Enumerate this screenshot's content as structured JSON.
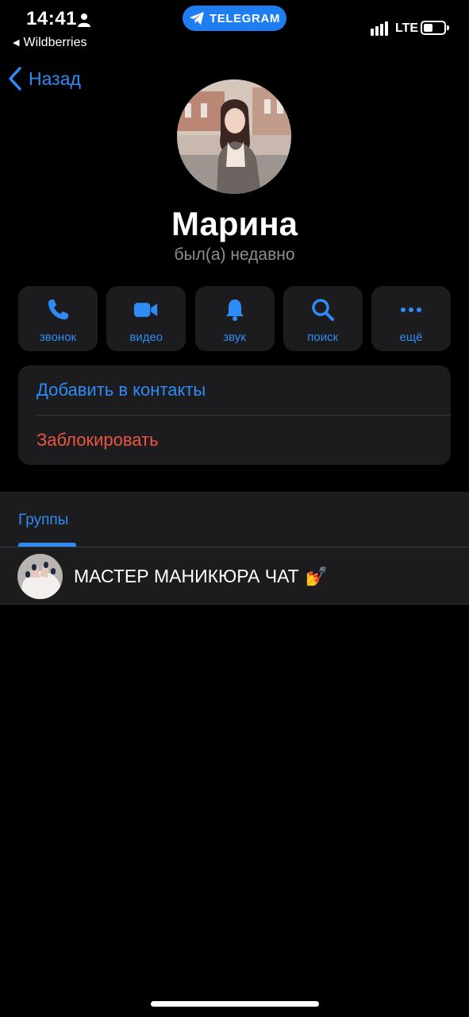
{
  "status_bar": {
    "time": "14:41",
    "back_app": "Wildberries",
    "pill_label": "TELEGRAM",
    "network": "LTE",
    "battery_level": 0.45
  },
  "nav": {
    "back_label": "Назад"
  },
  "profile": {
    "name": "Марина",
    "last_seen": "был(а) недавно"
  },
  "actions": [
    {
      "label": "звонок",
      "icon": "phone-icon"
    },
    {
      "label": "видео",
      "icon": "video-camera-icon"
    },
    {
      "label": "звук",
      "icon": "bell-icon"
    },
    {
      "label": "поиск",
      "icon": "search-icon"
    },
    {
      "label": "ещё",
      "icon": "more-dots-icon"
    }
  ],
  "contact_card": {
    "add_label": "Добавить в контакты",
    "block_label": "Заблокировать"
  },
  "groups": {
    "tab_label": "Группы",
    "items": [
      {
        "name": "МАСТЕР МАНИКЮРА ЧАТ",
        "emoji": "💅"
      }
    ]
  },
  "colors": {
    "accent": "#2f8bf5",
    "destructive": "#eb5545",
    "card_bg": "#1c1c1e",
    "pill": "#1e7ef0"
  }
}
